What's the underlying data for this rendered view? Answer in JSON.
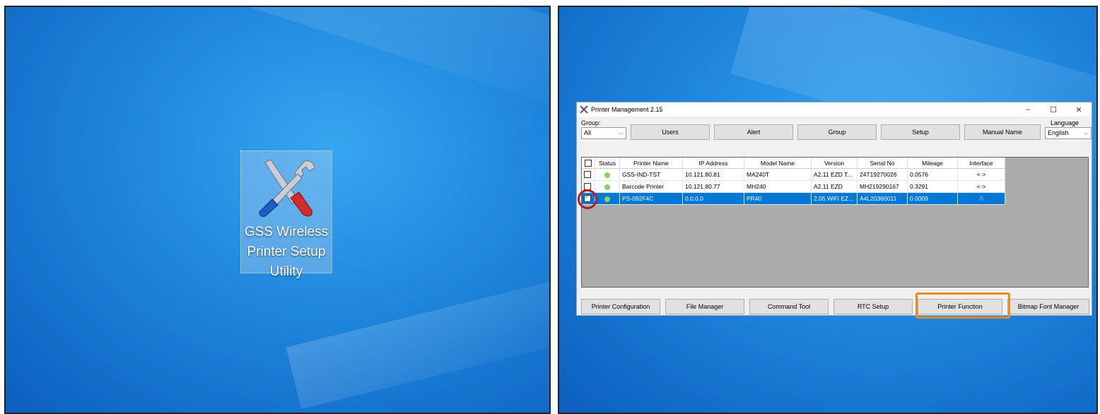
{
  "desktop": {
    "icon_label_lines": [
      "GSS Wireless",
      "Printer Setup",
      "Utility"
    ]
  },
  "window": {
    "title": "Printer Management 2.15",
    "controls": {
      "minimize": "–",
      "maximize": "☐",
      "close": "✕"
    },
    "group_label": "Group:",
    "group_value": "All",
    "language_label": "Language",
    "language_value": "English",
    "top_buttons": [
      "Users",
      "Alert",
      "Group",
      "Setup",
      "Manual Name"
    ],
    "columns": [
      "Status",
      "Printer Name",
      "IP Address",
      "Model Name",
      "Version",
      "Serial No",
      "Mileage",
      "Interface"
    ],
    "rows": [
      {
        "checked": false,
        "name": "GSS-IND-TST",
        "ip": "10.121.80.81",
        "model": "MA240T",
        "version": "A2.11 EZD T...",
        "serial": "24T19270026",
        "mileage": "0.0576",
        "interface": "<·>",
        "selected": false
      },
      {
        "checked": false,
        "name": "Barcode Printer",
        "ip": "10.121.80.77",
        "model": "MH240",
        "version": "A2.11 EZD",
        "serial": "MH219290167",
        "mileage": "0.3291",
        "interface": "<·>",
        "selected": false
      },
      {
        "checked": true,
        "name": "PS-092F4C",
        "ip": "0.0.0.0",
        "model": "PR40",
        "version": "2.05 WiFi EZ...",
        "serial": "A4L20360011",
        "mileage": "0.0009",
        "interface": "☃",
        "selected": true
      }
    ],
    "bottom_buttons": [
      "Printer Configuration",
      "File Manager",
      "Command Tool",
      "RTC Setup",
      "Printer Function",
      "Bitmap Font Manager"
    ]
  },
  "colors": {
    "highlight_circle": "#b81c1c",
    "highlight_rect": "#f08a1c",
    "selection": "#0078d7"
  }
}
